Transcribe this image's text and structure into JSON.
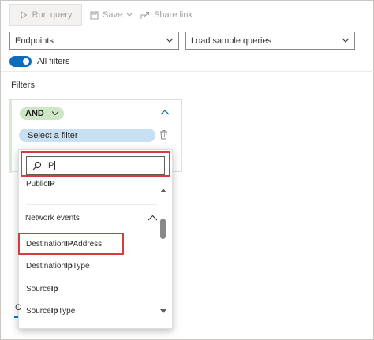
{
  "toolbar": {
    "run_query": "Run query",
    "save": "Save",
    "share_link": "Share link"
  },
  "dropdowns": {
    "endpoints": "Endpoints",
    "sample_queries": "Load sample queries"
  },
  "toggle": {
    "label": "All filters",
    "on": true
  },
  "filters_heading": "Filters",
  "group": {
    "operator": "AND",
    "select_filter_label": "Select a filter"
  },
  "popup": {
    "search_value": "IP",
    "items_above": [
      {
        "prefix": "Public",
        "bold": "IP",
        "suffix": ""
      }
    ],
    "section": {
      "title": "Network events",
      "items": [
        {
          "prefix": "Destination",
          "bold": "IP",
          "suffix": "Address"
        },
        {
          "prefix": "Destination",
          "bold": "Ip",
          "suffix": "Type"
        },
        {
          "prefix": "Source",
          "bold": "Ip",
          "suffix": ""
        },
        {
          "prefix": "Source",
          "bold": "Ip",
          "suffix": "Type"
        }
      ]
    }
  },
  "tab_fragment": "C",
  "colors": {
    "accent_blue": "#0f6cbd",
    "select_filter_bg": "#c7e0f4",
    "and_pill_bg": "#cde6c5",
    "highlight_red": "#d83b3b"
  }
}
